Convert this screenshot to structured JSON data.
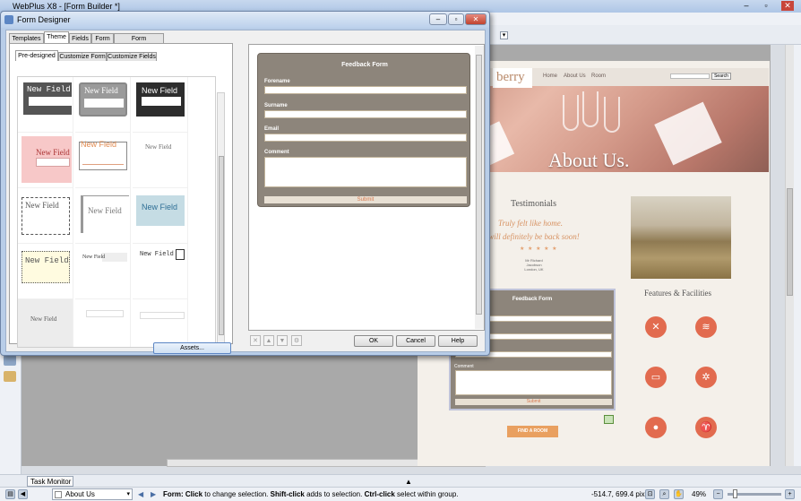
{
  "app": {
    "title": "WebPlus X8 - [Form Builder *]"
  },
  "dialog": {
    "title": "Form Designer",
    "tabs": [
      "Templates",
      "Theme",
      "Fields",
      "Form",
      "Form Submission"
    ],
    "active_tab": "Theme",
    "subtabs": [
      "Pre-designed",
      "Customize Form",
      "Customize Fields"
    ],
    "thumbnails": [
      "New Field",
      "New Field",
      "New Field",
      "New Field",
      "New Field",
      "New Field",
      "New Field",
      "New Field",
      "New Field",
      "New Field",
      "New Field",
      "New Field",
      "New Field",
      "",
      ""
    ],
    "assets_label": "Assets...",
    "preview": {
      "title": "Feedback Form",
      "fields": [
        "Forename",
        "Surname",
        "Email",
        "Comment"
      ],
      "submit": "Submit"
    },
    "buttons": {
      "ok": "OK",
      "cancel": "Cancel",
      "help": "Help"
    }
  },
  "webpage": {
    "logo": "berry",
    "nav": [
      "Home",
      "About Us",
      "Room"
    ],
    "search_btn": "Search",
    "hero_title": "About Us.",
    "testimonials_heading": "Testimonials",
    "quote_line1": "Truly felt like home.",
    "quote_line2": "I will definitely be back soon!",
    "stars": "★ ★ ★ ★ ★",
    "author_line1": "Mr Richard Jacobson",
    "author_line2": "London, UK",
    "features_heading": "Features & Facilities",
    "form_title": "Feedback Form",
    "form_comment_label": "Comment",
    "form_submit": "Submit",
    "find_room": "FIND A ROOM",
    "colors": {
      "accent": "#e26b4f",
      "form_bg": "#8d857b",
      "button": "#e9a060"
    }
  },
  "taskbar": {
    "task_monitor": "Task Monitor"
  },
  "status": {
    "page": "About Us",
    "message_parts": [
      "Form:",
      " Click",
      " to change selection. ",
      "Shift-click",
      " adds to selection. ",
      "Ctrl-click",
      " select within group."
    ],
    "coords": "-514.7, 699.4 pix",
    "zoom": "49%"
  }
}
